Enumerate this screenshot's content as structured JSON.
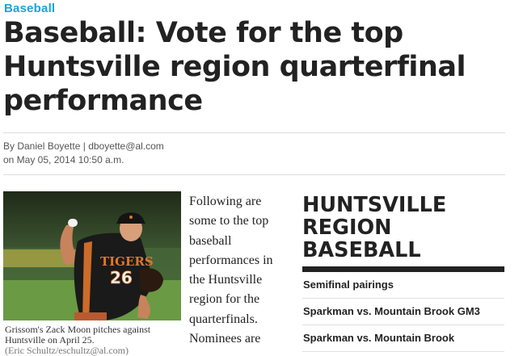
{
  "article": {
    "category": "Baseball",
    "headline_lines": [
      "Baseball: Vote for the top",
      "Huntsville region quarterfinal",
      "performance"
    ],
    "byline": {
      "prefix": "By ",
      "author": "Daniel Boyette",
      "separator": " | ",
      "email": "dboyette@al.com",
      "dateline": "on May 05, 2014 10:50 a.m."
    },
    "photo": {
      "jersey_text": "TIGERS",
      "jersey_number": "26",
      "caption_line1": "Grissom's Zack Moon pitches against",
      "caption_line2": "Huntsville on April 25.",
      "caption_line3": "(Eric Schultz/eschultz@al.com)"
    },
    "body_lines": [
      "Following are",
      "some to the top",
      "baseball",
      "performances in",
      "the Huntsville",
      "region for the",
      "quarterfinals.",
      "Nominees are"
    ]
  },
  "sidebar": {
    "title_lines": [
      "HUNTSVILLE",
      "REGION",
      "BASEBALL"
    ],
    "items": [
      {
        "label": "Semifinal pairings"
      },
      {
        "label": "Sparkman vs. Mountain Brook GM3"
      },
      {
        "label": "Sparkman vs. Mountain Brook"
      }
    ]
  },
  "colors": {
    "category": "#1ea3d6",
    "headline": "#222222",
    "sidebar_bar": "#222222",
    "jersey": "#1a1a1a",
    "jersey_trim": "#e0762c",
    "grass": "#4d7a33"
  }
}
